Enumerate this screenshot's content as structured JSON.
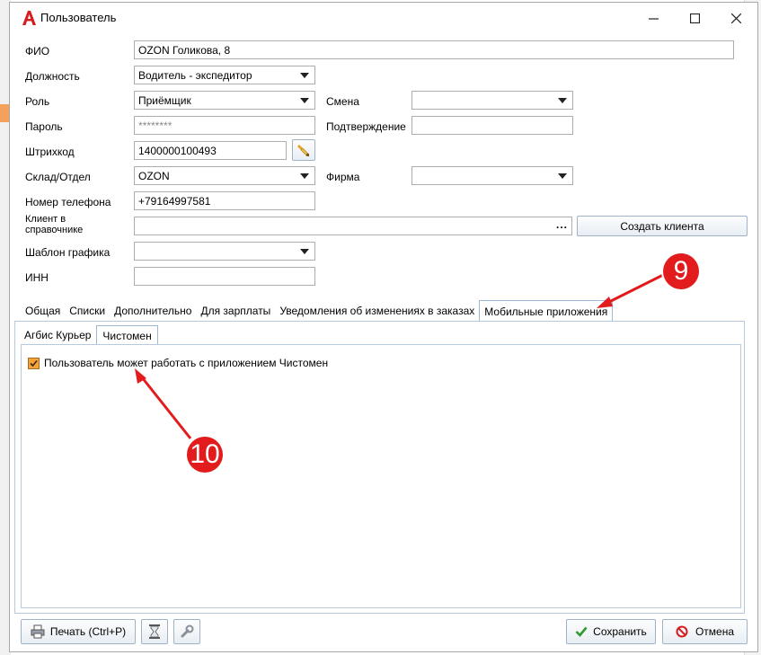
{
  "window": {
    "title": "Пользователь"
  },
  "form": {
    "fio": {
      "label": "ФИО",
      "value": "OZON Голикова, 8"
    },
    "position": {
      "label": "Должность",
      "value": "Водитель - экспедитор"
    },
    "role": {
      "label": "Роль",
      "value": "Приёмщик"
    },
    "shift": {
      "label": "Смена",
      "value": ""
    },
    "password": {
      "label": "Пароль",
      "value": "********"
    },
    "confirm": {
      "label": "Подтверждение",
      "value": ""
    },
    "barcode": {
      "label": "Штрихкод",
      "value": "1400000100493"
    },
    "warehouse": {
      "label": "Склад/Отдел",
      "value": "OZON"
    },
    "company": {
      "label": "Фирма",
      "value": ""
    },
    "phone": {
      "label": "Номер телефона",
      "value": "+79164997581"
    },
    "client": {
      "label_line1": "Клиент в",
      "label_line2": "справочнике",
      "value": "",
      "dots": "...",
      "create_label": "Создать клиента"
    },
    "schedule": {
      "label": "Шаблон графика",
      "value": ""
    },
    "inn": {
      "label": "ИНН",
      "value": ""
    }
  },
  "tabs": [
    "Общая",
    "Списки",
    "Дополнительно",
    "Для зарплаты",
    "Уведомления об изменениях в заказах",
    "Мобильные приложения"
  ],
  "subtabs": [
    "Агбис Курьер",
    "Чистомен"
  ],
  "checkbox": {
    "label": "Пользователь может работать с приложением Чистомен",
    "checked": true
  },
  "footer": {
    "print_label": "Печать (Ctrl+P)",
    "save_label": "Сохранить",
    "cancel_label": "Отмена"
  },
  "annotations": {
    "marker_9": "9",
    "marker_10": "10"
  },
  "colors": {
    "accent_orange": "#f7a33a",
    "marker_red": "#e21c1c",
    "tab_border": "#9db9d8"
  }
}
